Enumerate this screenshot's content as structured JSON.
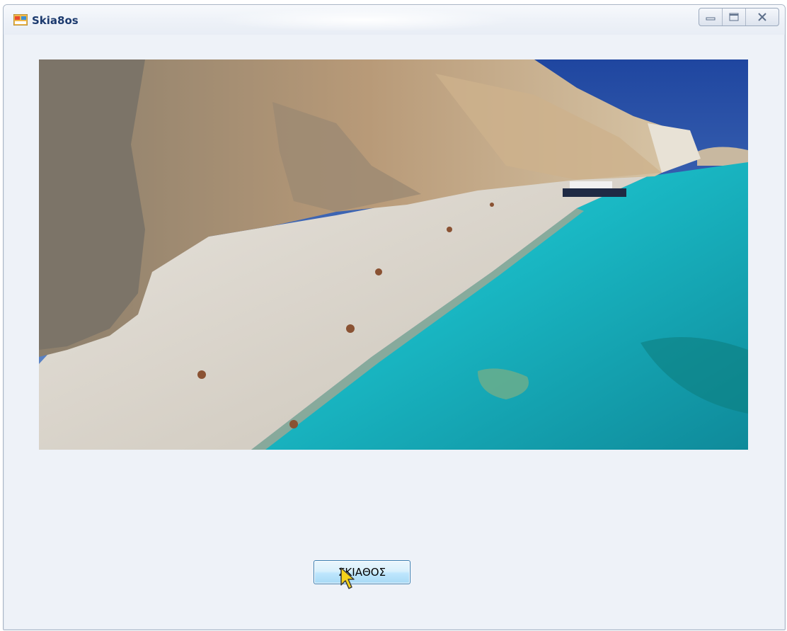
{
  "window": {
    "title": "Skia8os",
    "icon": "app-window-icon",
    "caption_buttons": [
      "minimize-icon",
      "maximize-icon",
      "close-icon"
    ]
  },
  "picture": {
    "subject": "beach-photo"
  },
  "button": {
    "label": "ΣΚΙΑΘΟΣ"
  },
  "cursor": {
    "icon": "arrow-cursor-icon"
  },
  "colors": {
    "window_bg": "#eef2f8",
    "title_text": "#1c3a6e",
    "button_border": "#3c7fb1",
    "sea": "#1fc1c9",
    "sky": "#2f5bb0"
  }
}
